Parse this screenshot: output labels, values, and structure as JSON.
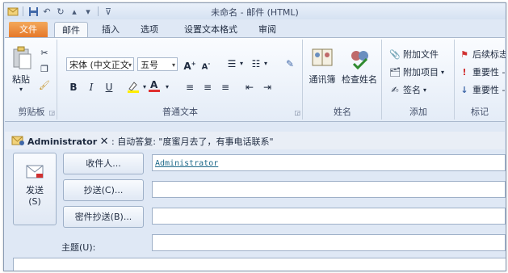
{
  "window": {
    "title": "未命名 - 邮件 (HTML)"
  },
  "qat": {
    "icons": [
      "outlook-icon",
      "save-icon",
      "undo-icon",
      "redo-icon",
      "up-icon",
      "down-icon",
      "customize-icon"
    ]
  },
  "tabs": {
    "file": "文件",
    "items": [
      {
        "label": "邮件",
        "active": true
      },
      {
        "label": "插入",
        "active": false
      },
      {
        "label": "选项",
        "active": false
      },
      {
        "label": "设置文本格式",
        "active": false
      },
      {
        "label": "审阅",
        "active": false
      }
    ]
  },
  "ribbon": {
    "clipboard": {
      "label": "剪贴板",
      "paste": "粘贴"
    },
    "basic_text": {
      "label": "普通文本",
      "font": "宋体 (中文正文",
      "size": "五号",
      "bold": "B",
      "italic": "I",
      "underline": "U"
    },
    "names": {
      "label": "姓名",
      "address_book": "通讯簿",
      "check_names": "检查姓名"
    },
    "include": {
      "label": "添加",
      "attach_file": "附加文件",
      "attach_item": "附加项目",
      "signature": "签名"
    },
    "tags": {
      "label": "标记",
      "follow_up": "后续标志",
      "high_importance": "重要性 -",
      "low_importance": "重要性 -"
    }
  },
  "infobar": {
    "name": "Administrator",
    "message": ": 自动答复: \"度蜜月去了，有事电话联系\""
  },
  "compose": {
    "send": "发送",
    "send_key": "(S)",
    "to_button": "收件人...",
    "cc_button": "抄送(C)...",
    "bcc_button": "密件抄送(B)...",
    "subject_label": "主题(U):",
    "to_value": "Administrator",
    "cc_value": "",
    "bcc_value": "",
    "subject_value": ""
  },
  "colors": {
    "file_tab": "#e5782a",
    "accent": "#1f6a8a",
    "highlight": "#ffee00",
    "font_red": "#e03030"
  }
}
